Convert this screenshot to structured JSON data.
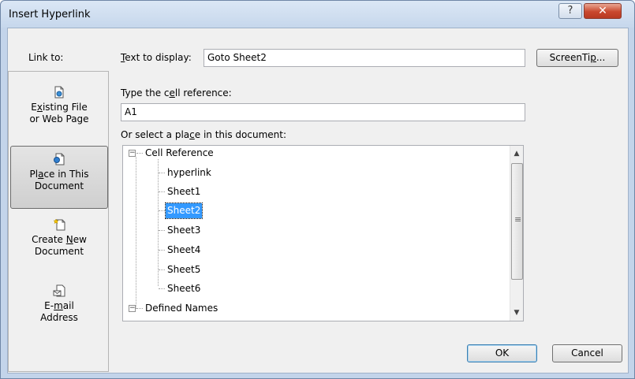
{
  "window": {
    "title": "Insert Hyperlink",
    "help_glyph": "?",
    "close_glyph": "✕"
  },
  "link_to": {
    "label": "Link to:",
    "items": [
      {
        "line1_pre": "",
        "line1_u": "x",
        "line1_post": "isting File",
        "line1_first": "E",
        "line2": "or Web Page",
        "icon": "existing-file-icon"
      },
      {
        "line1_pre": "Pl",
        "line1_u": "a",
        "line1_post": "ce in This",
        "line2": "Document",
        "icon": "place-in-document-icon"
      },
      {
        "line1_pre": "Create ",
        "line1_u": "N",
        "line1_post": "ew",
        "line2": "Document",
        "icon": "create-new-document-icon"
      },
      {
        "line1_pre": "E-",
        "line1_u": "m",
        "line1_post": "ail",
        "line2": "Address",
        "icon": "email-address-icon"
      }
    ]
  },
  "text_to_display": {
    "label_u": "T",
    "label_rest": "ext to display:",
    "value": "Goto Sheet2"
  },
  "screentip_button": {
    "pre": "ScreenTi",
    "u": "p",
    "post": "..."
  },
  "cell_reference": {
    "label_pre": "Type the c",
    "label_u": "e",
    "label_post": "ll reference:",
    "value": "A1"
  },
  "place_select": {
    "label_pre": "Or select a pla",
    "label_u": "c",
    "label_post": "e in this document:"
  },
  "tree": {
    "groups": [
      {
        "label": "Cell Reference",
        "children": [
          "hyperlink",
          "Sheet1",
          "Sheet2",
          "Sheet3",
          "Sheet4",
          "Sheet5",
          "Sheet6"
        ]
      },
      {
        "label": "Defined Names",
        "children": []
      }
    ],
    "selected": "Sheet2",
    "expander_glyph": "−",
    "scroll_up_glyph": "▲",
    "scroll_down_glyph": "▼",
    "grip_glyph": "≡"
  },
  "ok_button": {
    "label": "OK"
  },
  "cancel_button": {
    "label": "Cancel"
  },
  "colors": {
    "selection": "#3399ff",
    "title_bar": "#c6d7ec",
    "close_button": "#c9482e"
  }
}
